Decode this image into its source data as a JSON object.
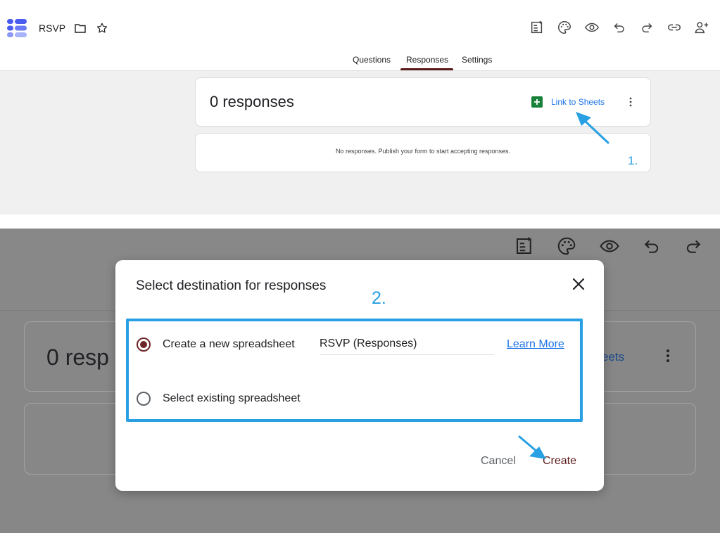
{
  "form": {
    "title": "RSVP"
  },
  "tabs": [
    {
      "label": "Questions"
    },
    {
      "label": "Responses"
    },
    {
      "label": "Settings"
    }
  ],
  "responses": {
    "count_label": "0 responses",
    "link_to_sheets": "Link to Sheets",
    "empty_message": "No responses. Publish your form to start accepting responses.",
    "truncated_count": "0 resp",
    "truncated_sheets": "eets"
  },
  "steps": {
    "step1": "1.",
    "step2": "2."
  },
  "dialog": {
    "title": "Select destination for responses",
    "option_new": "Create a new spreadsheet",
    "spreadsheet_name": "RSVP (Responses)",
    "learn_more": "Learn More",
    "option_existing": "Select existing spreadsheet",
    "cancel": "Cancel",
    "create": "Create",
    "selected_option": "new"
  },
  "colors": {
    "accent": "#5c1b1b",
    "link": "#1a73e8",
    "annotation": "#29a0e3",
    "sheets_green": "#188038"
  },
  "icons": {
    "top_toolbar": [
      "customize-icon",
      "palette-icon",
      "preview-eye-icon",
      "undo-icon",
      "redo-icon",
      "link-icon",
      "add-collaborator-icon"
    ]
  }
}
